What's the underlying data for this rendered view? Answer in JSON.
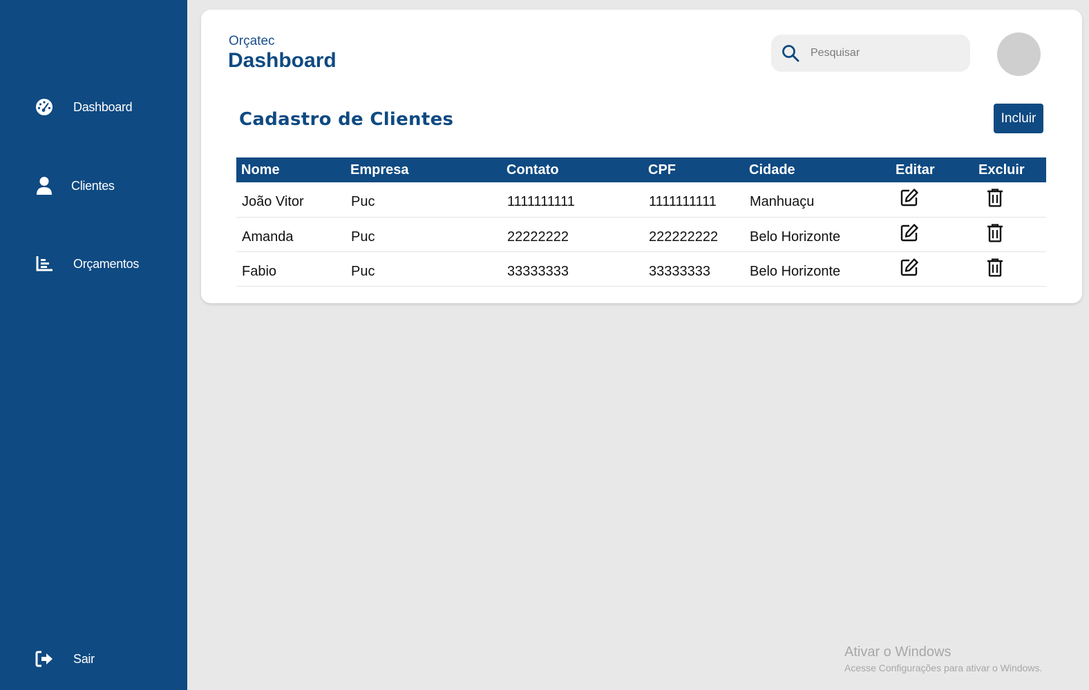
{
  "sidebar": {
    "items": [
      {
        "label": "Dashboard",
        "icon": "gauge-icon"
      },
      {
        "label": "Clientes",
        "icon": "user-icon"
      },
      {
        "label": "Orçamentos",
        "icon": "bar-chart-icon"
      }
    ],
    "logout": {
      "label": "Sair",
      "icon": "sign-out-icon"
    }
  },
  "header": {
    "brand": "Orçatec",
    "title": "Dashboard",
    "search_placeholder": "Pesquisar"
  },
  "section": {
    "title": "Cadastro de Clientes",
    "add_button": "Incluir"
  },
  "table": {
    "columns": [
      "Nome",
      "Empresa",
      "Contato",
      "CPF",
      "Cidade",
      "Editar",
      "Excluir"
    ],
    "rows": [
      {
        "nome": "João Vitor",
        "empresa": "Puc",
        "contato": "1111111111",
        "cpf": "1111111111",
        "cidade": "Manhuaçu"
      },
      {
        "nome": "Amanda",
        "empresa": "Puc",
        "contato": "22222222",
        "cpf": "222222222",
        "cidade": "Belo Horizonte"
      },
      {
        "nome": "Fabio",
        "empresa": "Puc",
        "contato": "33333333",
        "cpf": "33333333",
        "cidade": "Belo Horizonte"
      }
    ]
  },
  "watermark": {
    "line1": "Ativar o Windows",
    "line2": "Acesse Configurações para ativar o Windows."
  },
  "colors": {
    "primary": "#0f4a82",
    "background": "#e9e8e9",
    "card": "#ffffff"
  }
}
